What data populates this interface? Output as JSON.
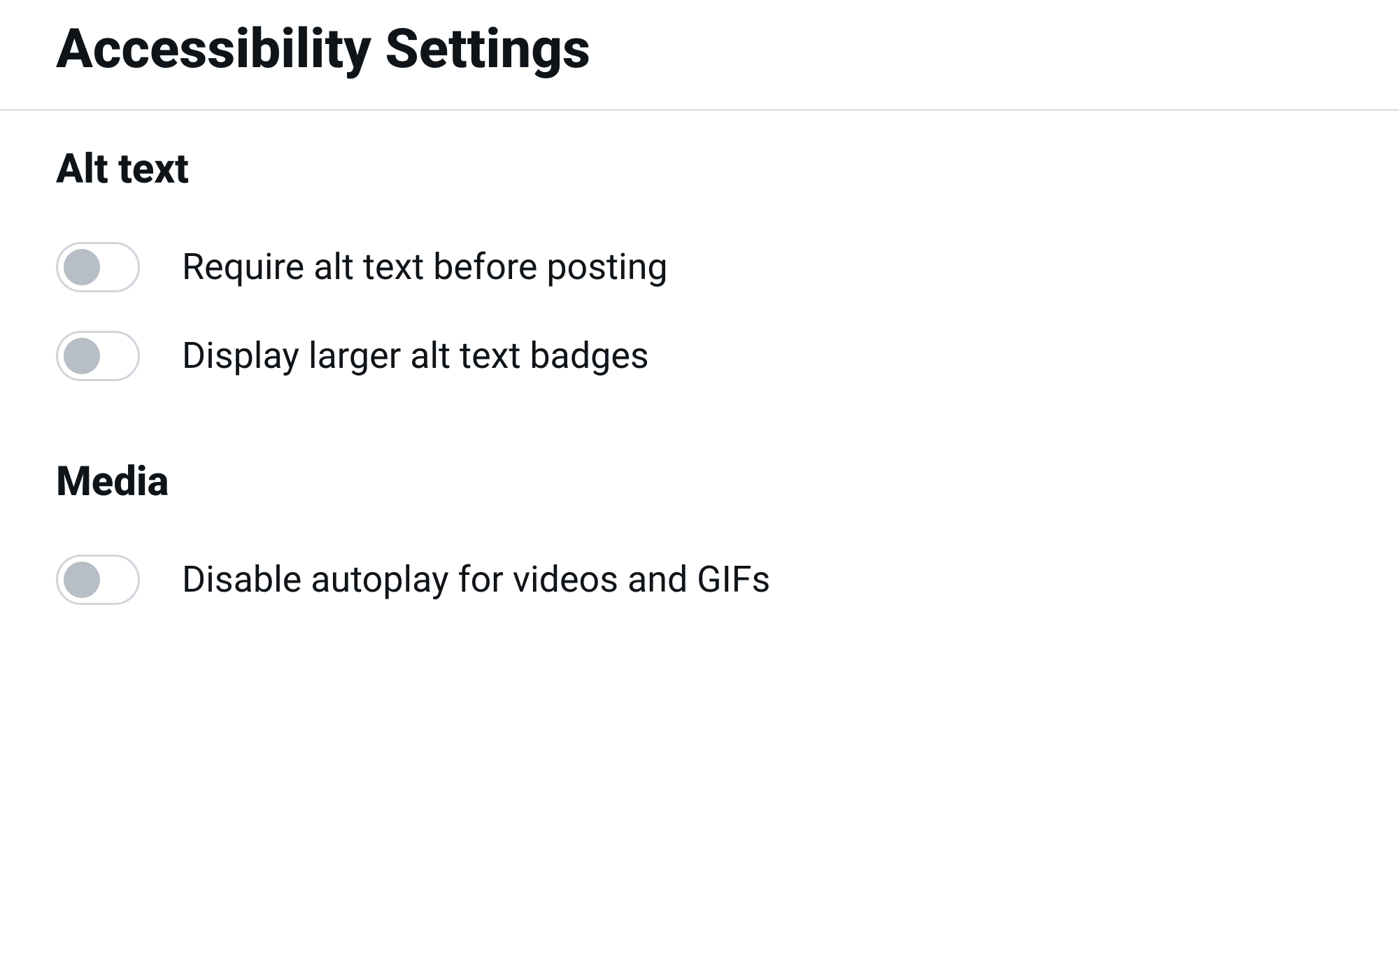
{
  "page_title": "Accessibility Settings",
  "sections": {
    "alt_text": {
      "heading": "Alt text",
      "items": [
        {
          "label": "Require alt text before posting",
          "enabled": false
        },
        {
          "label": "Display larger alt text badges",
          "enabled": false
        }
      ]
    },
    "media": {
      "heading": "Media",
      "items": [
        {
          "label": "Disable autoplay for videos and GIFs",
          "enabled": false
        }
      ]
    }
  }
}
